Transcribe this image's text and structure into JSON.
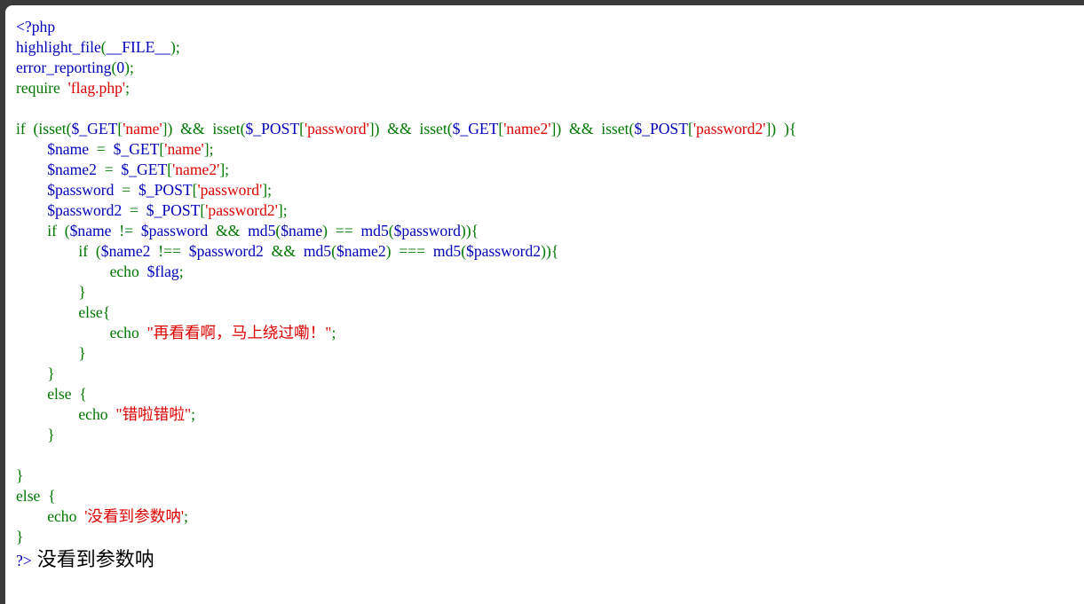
{
  "colors": {
    "html": "#000000",
    "default": "#0000BB",
    "keyword": "#007700",
    "string": "#DD0000",
    "page_background": "#ffffff",
    "window_chrome": "#3a3a3a"
  },
  "code_lines": [
    [
      {
        "t": "<?php",
        "c": "default"
      }
    ],
    [
      {
        "t": "highlight_file",
        "c": "default"
      },
      {
        "t": "(",
        "c": "keyword"
      },
      {
        "t": "__FILE__",
        "c": "default"
      },
      {
        "t": ");",
        "c": "keyword"
      }
    ],
    [
      {
        "t": "error_reporting",
        "c": "default"
      },
      {
        "t": "(",
        "c": "keyword"
      },
      {
        "t": "0",
        "c": "default"
      },
      {
        "t": ");",
        "c": "keyword"
      }
    ],
    [
      {
        "t": "require  ",
        "c": "keyword"
      },
      {
        "t": "'flag.php'",
        "c": "string"
      },
      {
        "t": ";",
        "c": "keyword"
      }
    ],
    [
      {
        "t": "",
        "c": "default"
      }
    ],
    [
      {
        "t": "if  (isset(",
        "c": "keyword"
      },
      {
        "t": "$_GET",
        "c": "default"
      },
      {
        "t": "[",
        "c": "keyword"
      },
      {
        "t": "'name'",
        "c": "string"
      },
      {
        "t": "])  &&  isset(",
        "c": "keyword"
      },
      {
        "t": "$_POST",
        "c": "default"
      },
      {
        "t": "[",
        "c": "keyword"
      },
      {
        "t": "'password'",
        "c": "string"
      },
      {
        "t": "])  &&  isset(",
        "c": "keyword"
      },
      {
        "t": "$_GET",
        "c": "default"
      },
      {
        "t": "[",
        "c": "keyword"
      },
      {
        "t": "'name2'",
        "c": "string"
      },
      {
        "t": "])  &&  isset(",
        "c": "keyword"
      },
      {
        "t": "$_POST",
        "c": "default"
      },
      {
        "t": "[",
        "c": "keyword"
      },
      {
        "t": "'password2'",
        "c": "string"
      },
      {
        "t": "])  ){",
        "c": "keyword"
      }
    ],
    [
      {
        "t": "        ",
        "c": "keyword"
      },
      {
        "t": "$name  ",
        "c": "default"
      },
      {
        "t": "=  ",
        "c": "keyword"
      },
      {
        "t": "$_GET",
        "c": "default"
      },
      {
        "t": "[",
        "c": "keyword"
      },
      {
        "t": "'name'",
        "c": "string"
      },
      {
        "t": "];",
        "c": "keyword"
      }
    ],
    [
      {
        "t": "        ",
        "c": "keyword"
      },
      {
        "t": "$name2  ",
        "c": "default"
      },
      {
        "t": "=  ",
        "c": "keyword"
      },
      {
        "t": "$_GET",
        "c": "default"
      },
      {
        "t": "[",
        "c": "keyword"
      },
      {
        "t": "'name2'",
        "c": "string"
      },
      {
        "t": "];",
        "c": "keyword"
      }
    ],
    [
      {
        "t": "        ",
        "c": "keyword"
      },
      {
        "t": "$password  ",
        "c": "default"
      },
      {
        "t": "=  ",
        "c": "keyword"
      },
      {
        "t": "$_POST",
        "c": "default"
      },
      {
        "t": "[",
        "c": "keyword"
      },
      {
        "t": "'password'",
        "c": "string"
      },
      {
        "t": "];",
        "c": "keyword"
      }
    ],
    [
      {
        "t": "        ",
        "c": "keyword"
      },
      {
        "t": "$password2  ",
        "c": "default"
      },
      {
        "t": "=  ",
        "c": "keyword"
      },
      {
        "t": "$_POST",
        "c": "default"
      },
      {
        "t": "[",
        "c": "keyword"
      },
      {
        "t": "'password2'",
        "c": "string"
      },
      {
        "t": "];",
        "c": "keyword"
      }
    ],
    [
      {
        "t": "        if  (",
        "c": "keyword"
      },
      {
        "t": "$name  ",
        "c": "default"
      },
      {
        "t": "!=  ",
        "c": "keyword"
      },
      {
        "t": "$password  ",
        "c": "default"
      },
      {
        "t": "&&  ",
        "c": "keyword"
      },
      {
        "t": "md5",
        "c": "default"
      },
      {
        "t": "(",
        "c": "keyword"
      },
      {
        "t": "$name",
        "c": "default"
      },
      {
        "t": ")  ==  ",
        "c": "keyword"
      },
      {
        "t": "md5",
        "c": "default"
      },
      {
        "t": "(",
        "c": "keyword"
      },
      {
        "t": "$password",
        "c": "default"
      },
      {
        "t": ")){",
        "c": "keyword"
      }
    ],
    [
      {
        "t": "                if  (",
        "c": "keyword"
      },
      {
        "t": "$name2  ",
        "c": "default"
      },
      {
        "t": "!==  ",
        "c": "keyword"
      },
      {
        "t": "$password2  ",
        "c": "default"
      },
      {
        "t": "&&  ",
        "c": "keyword"
      },
      {
        "t": "md5",
        "c": "default"
      },
      {
        "t": "(",
        "c": "keyword"
      },
      {
        "t": "$name2",
        "c": "default"
      },
      {
        "t": ")  ===  ",
        "c": "keyword"
      },
      {
        "t": "md5",
        "c": "default"
      },
      {
        "t": "(",
        "c": "keyword"
      },
      {
        "t": "$password2",
        "c": "default"
      },
      {
        "t": ")){",
        "c": "keyword"
      }
    ],
    [
      {
        "t": "                        echo  ",
        "c": "keyword"
      },
      {
        "t": "$flag",
        "c": "default"
      },
      {
        "t": ";",
        "c": "keyword"
      }
    ],
    [
      {
        "t": "                }",
        "c": "keyword"
      }
    ],
    [
      {
        "t": "                else{",
        "c": "keyword"
      }
    ],
    [
      {
        "t": "                        echo  ",
        "c": "keyword"
      },
      {
        "t": "\"再看看啊，马上绕过嘞！\"",
        "c": "string"
      },
      {
        "t": ";",
        "c": "keyword"
      }
    ],
    [
      {
        "t": "                }",
        "c": "keyword"
      }
    ],
    [
      {
        "t": "        }",
        "c": "keyword"
      }
    ],
    [
      {
        "t": "        else  {",
        "c": "keyword"
      }
    ],
    [
      {
        "t": "                echo  ",
        "c": "keyword"
      },
      {
        "t": "\"错啦错啦\"",
        "c": "string"
      },
      {
        "t": ";",
        "c": "keyword"
      }
    ],
    [
      {
        "t": "        }",
        "c": "keyword"
      }
    ],
    [
      {
        "t": "",
        "c": "default"
      }
    ],
    [
      {
        "t": "}",
        "c": "keyword"
      }
    ],
    [
      {
        "t": "else  {",
        "c": "keyword"
      }
    ],
    [
      {
        "t": "        echo  ",
        "c": "keyword"
      },
      {
        "t": "'没看到参数呐'",
        "c": "string"
      },
      {
        "t": ";",
        "c": "keyword"
      }
    ],
    [
      {
        "t": "}",
        "c": "keyword"
      }
    ]
  ],
  "output": {
    "php_close": "?>",
    "rendered_text": "没看到参数呐"
  }
}
